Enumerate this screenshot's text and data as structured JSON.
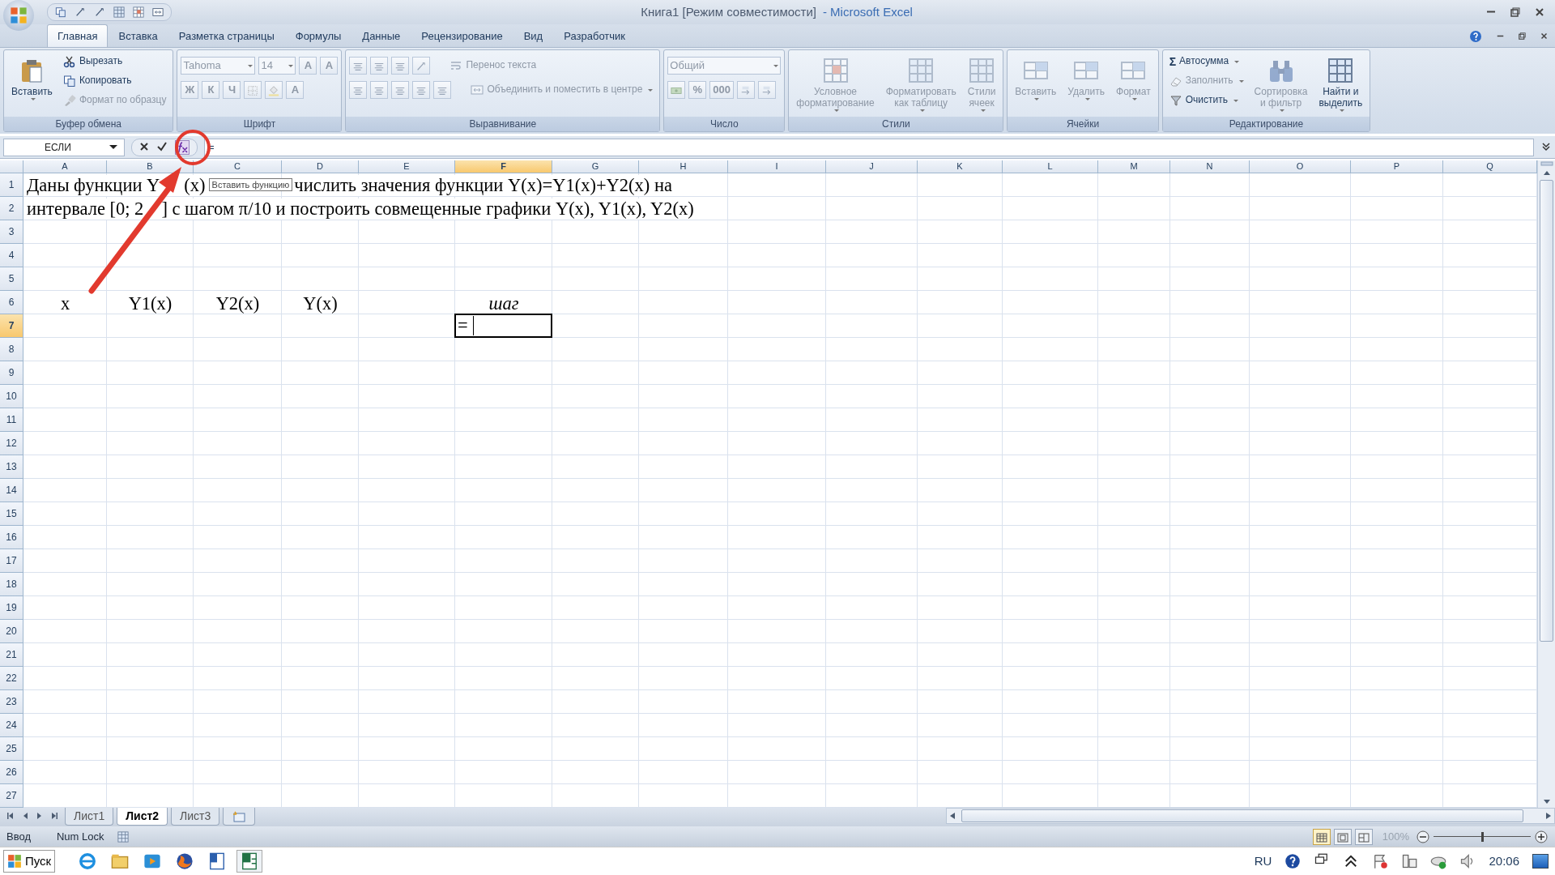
{
  "title_bar": {
    "document": "Книга1  [Режим совместимости]",
    "app": "- Microsoft Excel"
  },
  "ribbon_tabs": [
    {
      "label": "Главная",
      "selected": true
    },
    {
      "label": "Вставка",
      "selected": false
    },
    {
      "label": "Разметка страницы",
      "selected": false
    },
    {
      "label": "Формулы",
      "selected": false
    },
    {
      "label": "Данные",
      "selected": false
    },
    {
      "label": "Рецензирование",
      "selected": false
    },
    {
      "label": "Вид",
      "selected": false
    },
    {
      "label": "Разработчик",
      "selected": false
    }
  ],
  "ribbon_groups": [
    {
      "title": "Буфер обмена",
      "controls": [
        {
          "kind": "large",
          "lines": [
            "Вставить"
          ],
          "dropdown": true,
          "disabled": false
        },
        {
          "kind": "stack",
          "items": [
            {
              "label": "Вырезать",
              "disabled": false
            },
            {
              "label": "Копировать",
              "disabled": false
            },
            {
              "label": "Формат по образцу",
              "disabled": true
            }
          ]
        }
      ]
    },
    {
      "title": "Шрифт",
      "controls": [
        {
          "kind": "toolbar",
          "disabled": true,
          "items": [
            {
              "kind": "combo",
              "value": "Tahoma"
            },
            {
              "kind": "combo",
              "value": "14"
            },
            {
              "kind": "text",
              "text": "A"
            },
            {
              "kind": "text",
              "text": "A"
            }
          ]
        },
        {
          "kind": "toolbar",
          "disabled": true,
          "items": [
            {
              "kind": "text",
              "text": "Ж"
            },
            {
              "kind": "text",
              "text": "К"
            },
            {
              "kind": "text",
              "text": "Ч"
            },
            {
              "kind": "icon"
            },
            {
              "kind": "icon"
            },
            {
              "kind": "text",
              "text": "A"
            }
          ]
        }
      ]
    },
    {
      "title": "Выравнивание",
      "controls": [
        {
          "kind": "toolbar",
          "disabled": true,
          "items": [
            {
              "kind": "icon"
            },
            {
              "kind": "icon"
            },
            {
              "kind": "icon"
            },
            {
              "kind": "icon"
            },
            {
              "kind": "small",
              "label": "Перенос текста"
            }
          ]
        },
        {
          "kind": "toolbar",
          "disabled": true,
          "items": [
            {
              "kind": "icon"
            },
            {
              "kind": "icon"
            },
            {
              "kind": "icon"
            },
            {
              "kind": "icon"
            },
            {
              "kind": "icon"
            },
            {
              "kind": "small",
              "label": "Объединить и поместить в центре"
            }
          ]
        }
      ]
    },
    {
      "title": "Число",
      "controls": [
        {
          "kind": "toolbar",
          "disabled": true,
          "items": [
            {
              "kind": "combo",
              "value": "Общий"
            }
          ]
        },
        {
          "kind": "toolbar",
          "disabled": true,
          "items": [
            {
              "kind": "icon"
            },
            {
              "kind": "text",
              "text": "%"
            },
            {
              "kind": "text",
              "text": "000"
            },
            {
              "kind": "icon"
            },
            {
              "kind": "icon"
            }
          ]
        }
      ]
    },
    {
      "title": "Стили",
      "controls": [
        {
          "kind": "large",
          "lines": [
            "Условное",
            "форматирование"
          ],
          "dropdown": true,
          "disabled": true
        },
        {
          "kind": "large",
          "lines": [
            "Форматировать",
            "как таблицу"
          ],
          "dropdown": true,
          "disabled": true
        },
        {
          "kind": "large",
          "lines": [
            "Стили",
            "ячеек"
          ],
          "dropdown": true,
          "disabled": true
        }
      ]
    },
    {
      "title": "Ячейки",
      "controls": [
        {
          "kind": "large",
          "lines": [
            "Вставить"
          ],
          "dropdown": true,
          "disabled": true
        },
        {
          "kind": "large",
          "lines": [
            "Удалить"
          ],
          "dropdown": true,
          "disabled": true
        },
        {
          "kind": "large",
          "lines": [
            "Формат"
          ],
          "dropdown": true,
          "disabled": true
        }
      ]
    },
    {
      "title": "Редактирование",
      "controls": [
        {
          "kind": "stack",
          "items": [
            {
              "label": "Автосумма",
              "glyph": "Σ",
              "disabled": false,
              "dropdown": true
            },
            {
              "label": "Заполнить",
              "disabled": true,
              "dropdown": true
            },
            {
              "label": "Очистить",
              "disabled": false,
              "dropdown": true
            }
          ]
        },
        {
          "kind": "large",
          "lines": [
            "Сортировка",
            "и фильтр"
          ],
          "dropdown": true,
          "disabled": true
        },
        {
          "kind": "large",
          "lines": [
            "Найти и",
            "выделить"
          ],
          "dropdown": true,
          "disabled": false
        }
      ]
    }
  ],
  "formula_bar": {
    "name_box": "ЕСЛИ",
    "formula": "=",
    "tooltip": "Вставить функцию"
  },
  "sheet": {
    "columns": [
      {
        "label": "A",
        "selected": false
      },
      {
        "label": "B",
        "selected": false
      },
      {
        "label": "C",
        "selected": false
      },
      {
        "label": "D",
        "selected": false
      },
      {
        "label": "E",
        "selected": false
      },
      {
        "label": "F",
        "selected": true
      },
      {
        "label": "G",
        "selected": false
      },
      {
        "label": "H",
        "selected": false
      },
      {
        "label": "I",
        "selected": false
      },
      {
        "label": "J",
        "selected": false
      },
      {
        "label": "K",
        "selected": false
      },
      {
        "label": "L",
        "selected": false
      },
      {
        "label": "M",
        "selected": false
      },
      {
        "label": "N",
        "selected": false
      },
      {
        "label": "O",
        "selected": false
      },
      {
        "label": "P",
        "selected": false
      },
      {
        "label": "Q",
        "selected": false
      }
    ],
    "rows": [
      {
        "label": "1",
        "selected": false,
        "runs": [
          "Даны функции Y",
          "(x)",
          "числить значения функции Y(x)=Y1(x)+Y2(x) на"
        ]
      },
      {
        "label": "2",
        "selected": false,
        "runs": [
          "интервале [0; 2",
          "] с шагом π/10 и построить совмещенные графики Y(x), Y1(x), Y2(x)"
        ]
      },
      {
        "label": "3",
        "selected": false
      },
      {
        "label": "4",
        "selected": false
      },
      {
        "label": "5",
        "selected": false
      },
      {
        "label": "6",
        "selected": false,
        "cells": [
          {
            "text": "x"
          },
          {
            "text": "Y1(x)"
          },
          {
            "text": "Y2(x)"
          },
          {
            "text": "Y(x)"
          },
          {
            "kind": "empty"
          },
          {
            "text": "шаг",
            "kind": "italic"
          }
        ]
      },
      {
        "label": "7",
        "selected": true,
        "cells": [
          {
            "kind": "empty"
          },
          {
            "kind": "empty"
          },
          {
            "kind": "empty"
          },
          {
            "kind": "empty"
          },
          {
            "kind": "empty"
          },
          {
            "text": "=",
            "kind": "editing"
          }
        ]
      },
      {
        "label": "8",
        "selected": false
      },
      {
        "label": "9",
        "selected": false
      },
      {
        "label": "10",
        "selected": false
      },
      {
        "label": "11",
        "selected": false
      },
      {
        "label": "12",
        "selected": false
      },
      {
        "label": "13",
        "selected": false
      },
      {
        "label": "14",
        "selected": false
      },
      {
        "label": "15",
        "selected": false
      },
      {
        "label": "16",
        "selected": false
      },
      {
        "label": "17",
        "selected": false
      },
      {
        "label": "18",
        "selected": false
      },
      {
        "label": "19",
        "selected": false
      },
      {
        "label": "20",
        "selected": false
      },
      {
        "label": "21",
        "selected": false
      },
      {
        "label": "22",
        "selected": false
      },
      {
        "label": "23",
        "selected": false
      },
      {
        "label": "24",
        "selected": false
      },
      {
        "label": "25",
        "selected": false
      },
      {
        "label": "26",
        "selected": false
      },
      {
        "label": "27",
        "selected": false
      }
    ]
  },
  "sheet_tabs": [
    {
      "label": "Лист1",
      "selected": false
    },
    {
      "label": "Лист2",
      "selected": true
    },
    {
      "label": "Лист3",
      "selected": false
    }
  ],
  "status_bar": {
    "mode": "Ввод",
    "num_lock": "Num Lock",
    "views": [
      {
        "selected": true
      },
      {
        "selected": false
      },
      {
        "selected": false
      }
    ],
    "zoom": "100%",
    "zoom_slider": {
      "level": 0.5
    }
  },
  "taskbar": {
    "start": "Пуск",
    "apps": [
      {
        "selected": false
      },
      {
        "selected": false
      },
      {
        "selected": false
      },
      {
        "selected": false
      },
      {
        "selected": false
      },
      {
        "selected": true
      }
    ],
    "language": "RU",
    "clock": "20:06"
  }
}
